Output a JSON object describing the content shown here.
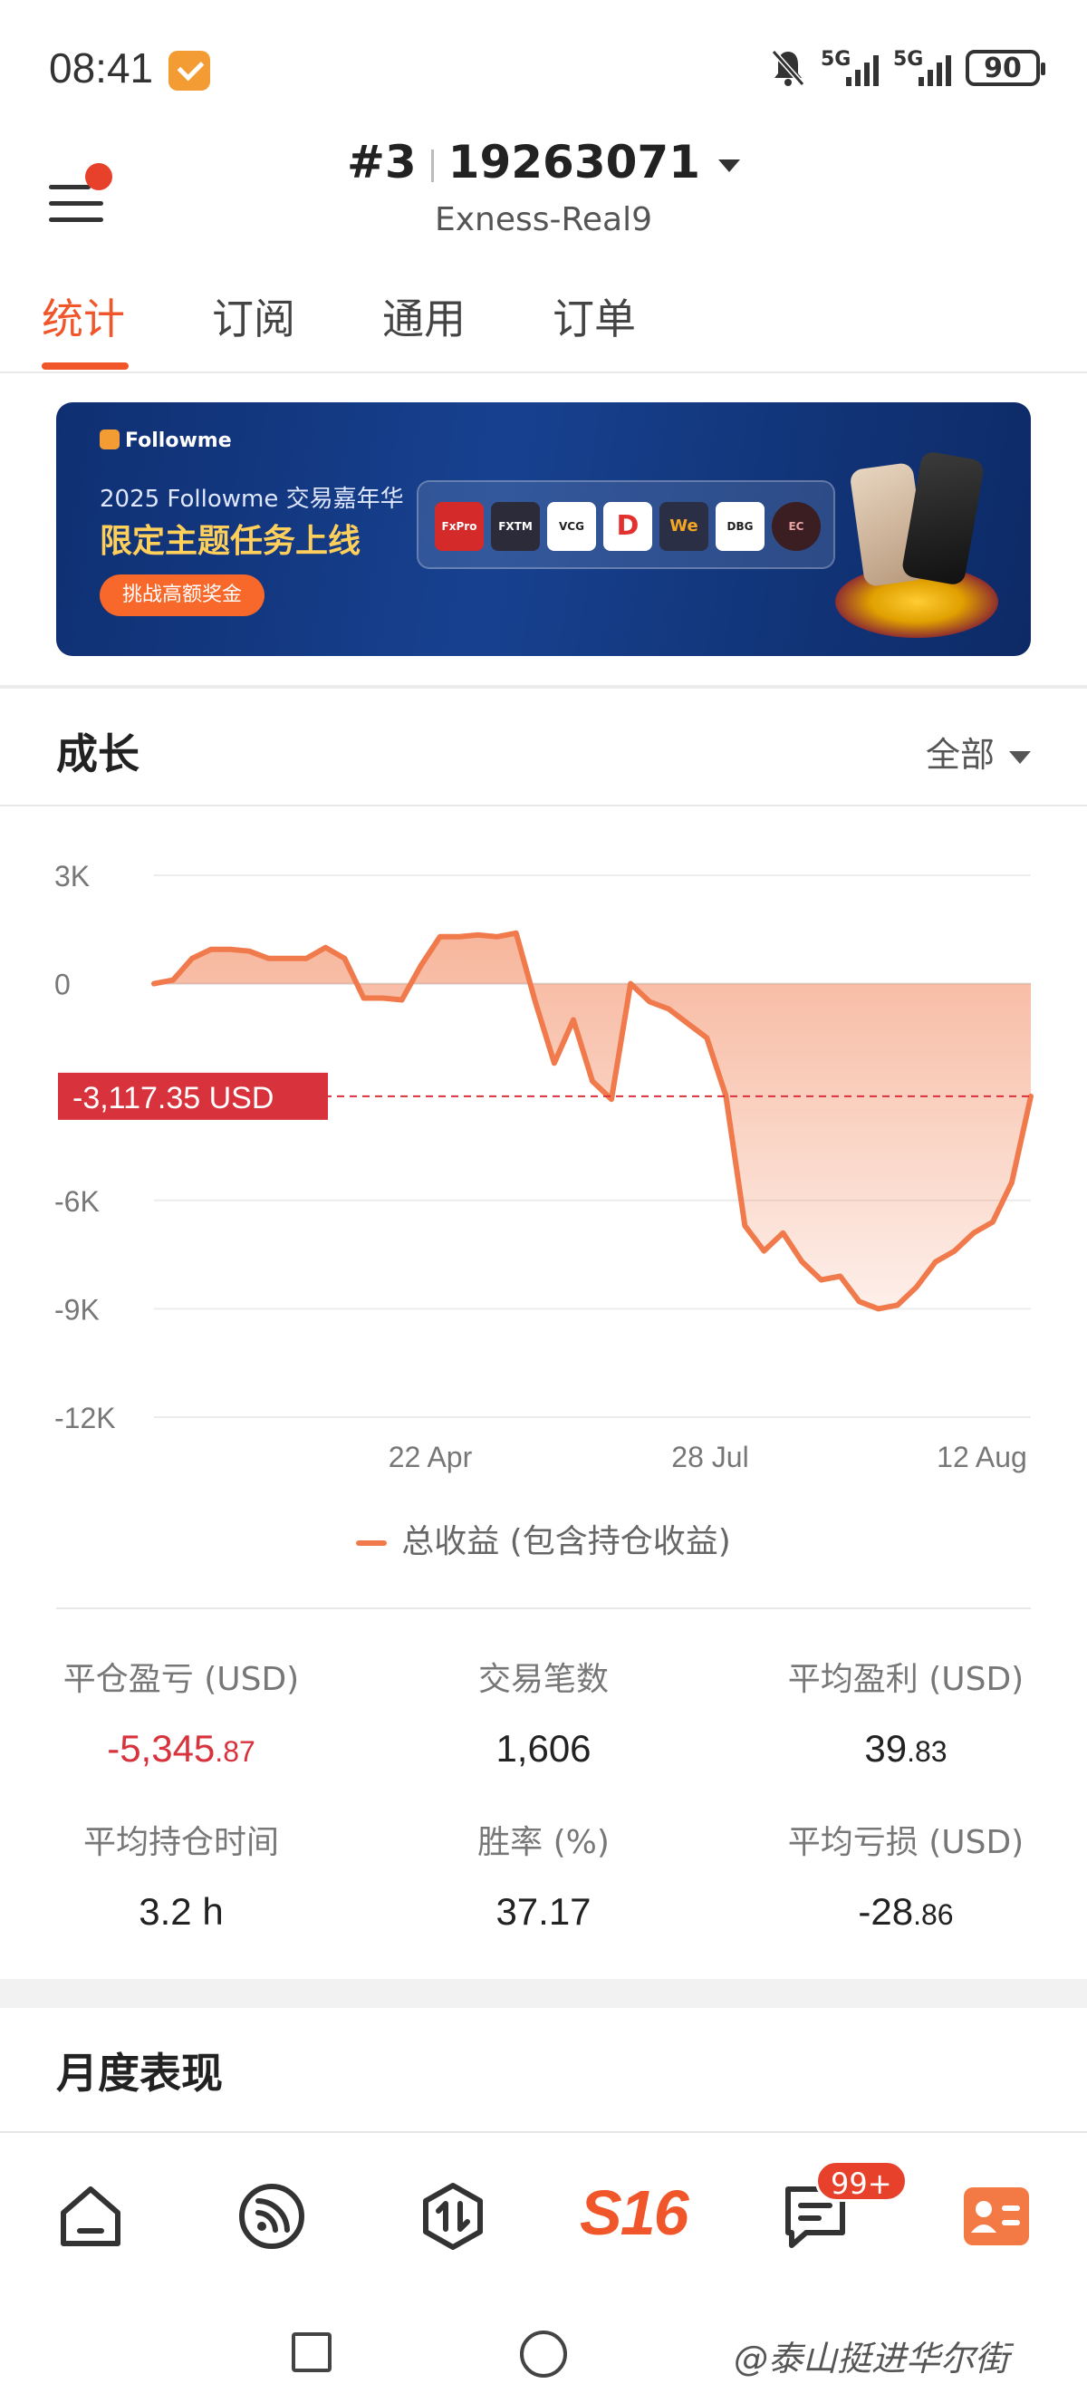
{
  "status_bar": {
    "time": "08:41",
    "network1": "5G",
    "network2": "5G",
    "battery": "90"
  },
  "header": {
    "account_index": "#3",
    "account_number": "19263071",
    "server": "Exness-Real9"
  },
  "tabs": [
    {
      "label": "统计",
      "active": true
    },
    {
      "label": "订阅",
      "active": false
    },
    {
      "label": "通用",
      "active": false
    },
    {
      "label": "订单",
      "active": false
    }
  ],
  "banner": {
    "brand": "Followme",
    "line1": "2025 Followme 交易嘉年华",
    "line2": "限定主题任务上线",
    "cta": "挑战高额奖金",
    "partners": [
      "FxPro",
      "FXTM",
      "VCG",
      "D",
      "We",
      "DBG",
      "EC"
    ]
  },
  "growth": {
    "title": "成长",
    "filter": "全部",
    "current_value_label": "-3,117.35 USD",
    "legend": "总收益 (包含持仓收益)"
  },
  "chart_data": {
    "type": "area",
    "y_ticks": [
      "3K",
      "0",
      "-6K",
      "-9K",
      "-12K"
    ],
    "x_ticks": [
      "22 Apr",
      "28 Jul",
      "12 Aug"
    ],
    "ylim": [
      -12000,
      3000
    ],
    "series": [
      {
        "name": "总收益 (包含持仓收益)",
        "values": [
          0,
          100,
          700,
          950,
          950,
          900,
          700,
          700,
          700,
          1000,
          700,
          -400,
          -400,
          -450,
          500,
          1300,
          1300,
          1350,
          1300,
          1400,
          -500,
          -2200,
          -1000,
          -2700,
          -3200,
          0,
          -500,
          -700,
          -1100,
          -1500,
          -3100,
          -6700,
          -7400,
          -6900,
          -7700,
          -8200,
          -8100,
          -8800,
          -9000,
          -8900,
          -8400,
          -7700,
          -7400,
          -6900,
          -6600,
          -5500,
          -3117.35
        ],
        "color": "#f07a4b"
      }
    ],
    "reference_value": -3117.35
  },
  "stats": [
    {
      "label": "平仓盈亏 (USD)",
      "main": "-5,345",
      "frac": ".87",
      "negative": true
    },
    {
      "label": "交易笔数",
      "main": "1,606",
      "frac": "",
      "negative": false
    },
    {
      "label": "平均盈利 (USD)",
      "main": "39",
      "frac": ".83",
      "negative": false
    },
    {
      "label": "平均持仓时间",
      "main": "3.2 h",
      "frac": "",
      "negative": false
    },
    {
      "label": "胜率 (%)",
      "main": "37.17",
      "frac": "",
      "negative": false
    },
    {
      "label": "平均亏损 (USD)",
      "main": "-28",
      "frac": ".86",
      "negative": false
    }
  ],
  "monthly": {
    "title": "月度表现"
  },
  "bottom_nav": {
    "badge": "99+",
    "s16": "S16"
  },
  "watermark": "@泰山挺进华尔街"
}
